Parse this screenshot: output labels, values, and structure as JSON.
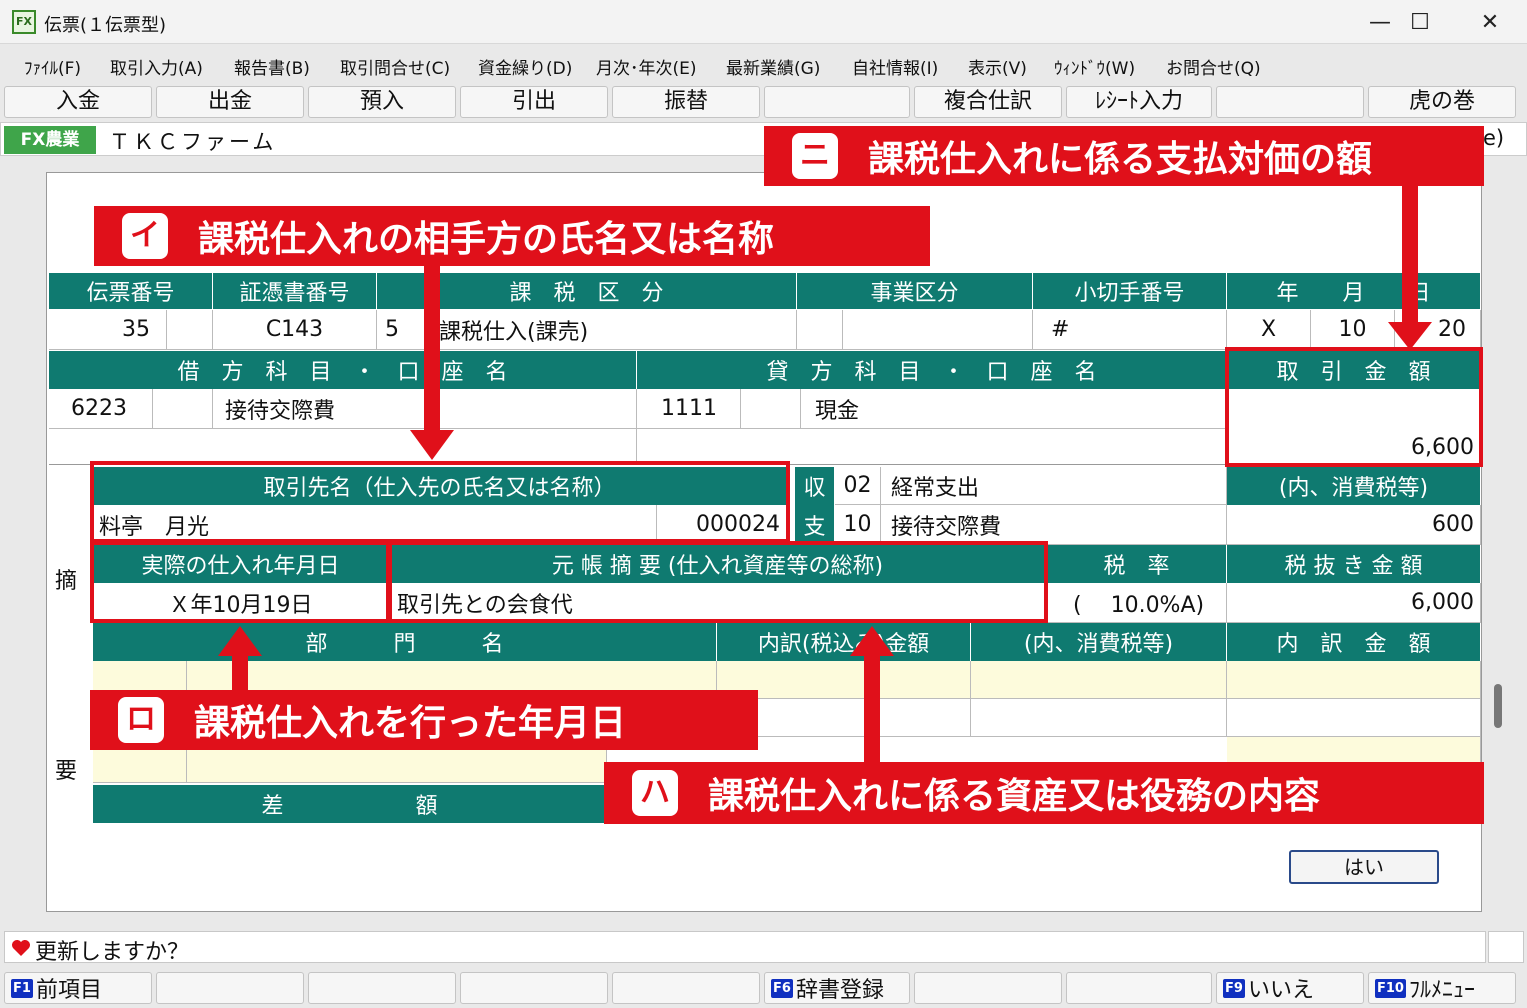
{
  "window": {
    "title": "伝票(１伝票型)",
    "icon": "fx-app-icon",
    "controls": {
      "minimize": "—",
      "maximize": "☐",
      "close": "✕"
    }
  },
  "menu": [
    "ﾌｧｲﾙ(F)",
    "取引入力(A)",
    "報告書(B)",
    "取引問合せ(C)",
    "資金繰り(D)",
    "月次･年次(E)",
    "最新業績(G)",
    "自社情報(I)",
    "表示(V)",
    "ｳｨﾝﾄﾞｳ(W)",
    "お問合せ(Q)"
  ],
  "function_buttons": [
    "入金",
    "出金",
    "預入",
    "引出",
    "振替",
    "",
    "複合仕訳",
    "ﾚｼｰﾄ入力",
    "",
    "虎の巻"
  ],
  "company": {
    "badge": "FX農業",
    "name": "ＴＫＣファーム",
    "tail": "e)"
  },
  "form": {
    "headers": {
      "voucher_no": "伝票番号",
      "document_no": "証憑書番号",
      "tax_category": "課　税　区　分",
      "business_category": "事業区分",
      "check_no": "小切手番号",
      "date": "年　　月　　日",
      "debit": "借　方　科　目　・　口　座　名",
      "credit": "貸　方　科　目　・　口　座　名",
      "amount": "取　引　金　額",
      "partner": "取引先名（仕入先の氏名又は名称）",
      "tax_incl": "(内、消費税等)",
      "actual_date": "実際の仕入れ年月日",
      "ledger_summary": "元 帳 摘 要 (仕入れ資産等の総称)",
      "tax_rate": "税　率",
      "excl_amount": "税 抜 き 金 額",
      "department": "部　　　門　　　名",
      "breakdown_incl": "内訳(税込み)金額",
      "breakdown_tax": "(内、消費税等)",
      "breakdown_amount": "内　訳　金　額",
      "difference": "差　　　　　　額",
      "summary_side_1": "摘",
      "summary_side_2": "要"
    },
    "row1": {
      "voucher_no": "35",
      "document_no": "C143",
      "tax_code": "5",
      "tax_label": "課税仕入(課売)",
      "check_no": "#",
      "year": "X",
      "month": "10",
      "day": "20"
    },
    "row2": {
      "debit_code": "6223",
      "debit_name": "接待交際費",
      "credit_code": "1111",
      "credit_name": "現金",
      "amount": "6,600"
    },
    "partner": {
      "name": "料亭　月光",
      "code": "000024"
    },
    "flow": [
      {
        "label": "収",
        "code": "02",
        "name": "経常支出"
      },
      {
        "label": "支",
        "code": "10",
        "name": "接待交際費"
      }
    ],
    "tax_amount": "600",
    "actual_date": "Ｘ年10月19日",
    "ledger_summary": "取引先との会食代",
    "tax_rate": "(　 10.0%A)",
    "excl_amount": "6,000",
    "ok_button": "はい"
  },
  "annotations": {
    "ni": {
      "icon": "ニ",
      "text": "課税仕入れに係る支払対価の額"
    },
    "i": {
      "icon": "イ",
      "text": "課税仕入れの相手方の氏名又は名称"
    },
    "ro": {
      "icon": "ロ",
      "text": "課税仕入れを行った年月日"
    },
    "ha": {
      "icon": "ハ",
      "text": "課税仕入れに係る資産又は役務の内容"
    },
    "color": "#e0101a"
  },
  "status": {
    "text": "更新しますか？",
    "icon": "heart-icon"
  },
  "fkeys": [
    {
      "key": "F1",
      "label": "前項目"
    },
    {
      "key": "F6",
      "label": "辞書登録"
    },
    {
      "key": "F9",
      "label": "いいえ"
    },
    {
      "key": "F10",
      "label": "ﾌﾙﾒﾆｭｰ"
    }
  ]
}
